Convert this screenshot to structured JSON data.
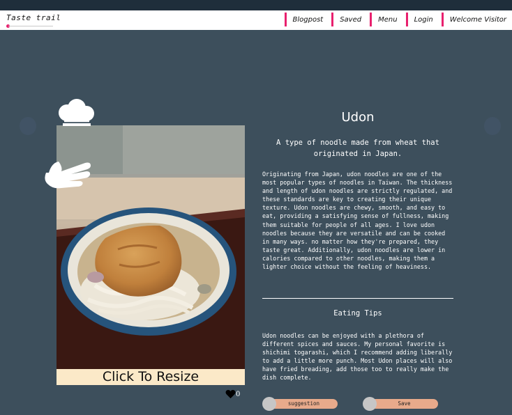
{
  "navbar": {
    "logo": "Taste trail",
    "links": [
      "Blogpost",
      "Saved",
      "Menu",
      "Login",
      "Welcome Visitor"
    ]
  },
  "photo_card": {
    "resize_label": "Click To Resize",
    "like_count": "0"
  },
  "article": {
    "title": "Udon",
    "subtitle": "A type of noodle made from wheat that originated in Japan.",
    "body": "Originating from Japan, udon noodles are one of the most popular types of noodles in Taiwan. The thickness and length of udon noodles are strictly regulated, and these standards are key to creating their unique texture. Udon noodles are chewy, smooth, and easy to eat, providing a satisfying sense of fullness, making them suitable for people of all ages. I love udon noodles because they are versatile and can be cooked in many ways. no matter how they're prepared, they taste great. Additionally, udon noodles are lower in calories compared to other noodles, making them a lighter choice without the feeling of heaviness.",
    "tips_title": "Eating Tips",
    "tips_body": "Udon noodles can be enjoyed with a plethora of different spices and sauces. My personal favorite is shichimi togarashi, which I recommend adding liberally to add a little more punch. Most Udon places will also have fried breading, add those too to really make the dish complete."
  },
  "buttons": {
    "suggestion": "suggestion",
    "save": "Save"
  },
  "colors": {
    "background": "#3d4f5c",
    "accent": "#e8206e",
    "button": "#e8aa8b",
    "resize_bar": "#fbe9c8"
  },
  "icons": [
    "chef-hat-icon",
    "hand-icon",
    "heart-icon"
  ]
}
